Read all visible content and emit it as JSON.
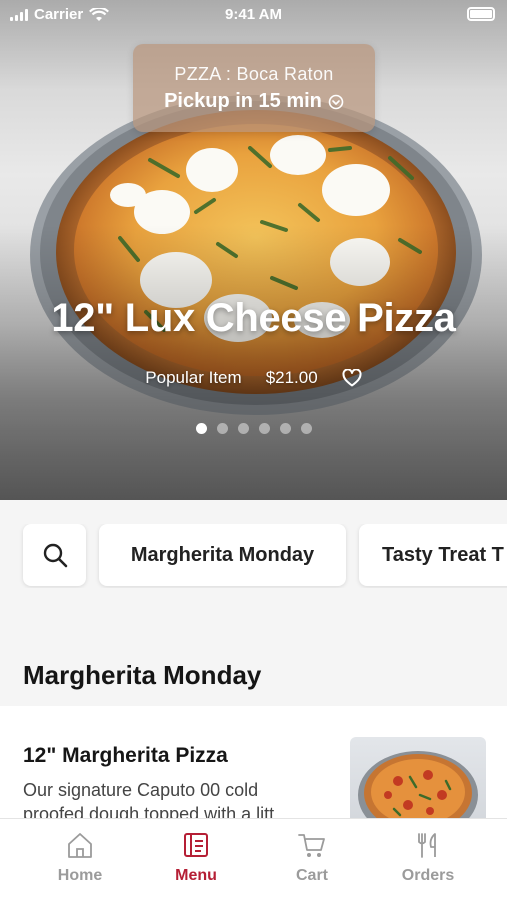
{
  "status_bar": {
    "carrier": "Carrier",
    "time": "9:41 AM"
  },
  "location": {
    "store": "PZZA : Boca Raton",
    "pickup": "Pickup in 15 min"
  },
  "hero": {
    "title": "12\" Lux Cheese Pizza",
    "tag": "Popular Item",
    "price": "$21.00",
    "carousel": {
      "total": 6,
      "active_index": 0
    }
  },
  "filters": {
    "search_icon": "search-icon",
    "chips": [
      "Margherita Monday",
      "Tasty Treat T"
    ]
  },
  "section": {
    "title": "Margherita Monday"
  },
  "item": {
    "name": "12\" Margherita Pizza",
    "description": "Our signature Caputo 00 cold proofed dough topped with a litt..."
  },
  "tabs": [
    {
      "label": "Home",
      "icon": "home-icon",
      "active": false
    },
    {
      "label": "Menu",
      "icon": "menu-icon",
      "active": true
    },
    {
      "label": "Cart",
      "icon": "cart-icon",
      "active": false
    },
    {
      "label": "Orders",
      "icon": "orders-icon",
      "active": false
    }
  ],
  "colors": {
    "accent": "#b51f35",
    "inactive_tab": "#9b9b9b"
  }
}
